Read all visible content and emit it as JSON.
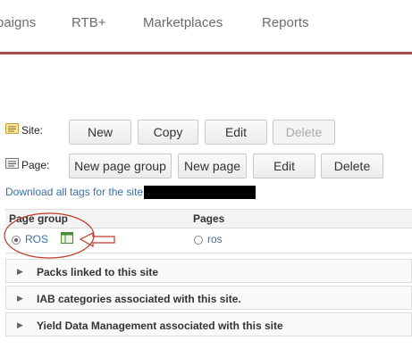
{
  "nav": {
    "items": [
      "paigns",
      "RTB+",
      "Marketplaces",
      "Reports"
    ]
  },
  "site": {
    "label": "Site:",
    "buttons": [
      "New",
      "Copy",
      "Edit",
      "Delete"
    ]
  },
  "page": {
    "label": "Page:",
    "buttons": [
      "New page group",
      "New page",
      "Edit",
      "Delete"
    ]
  },
  "download": {
    "text": "Download all tags for the site"
  },
  "table": {
    "headers": [
      "Page group",
      "Pages"
    ],
    "row": {
      "group": "ROS",
      "page": "ros"
    }
  },
  "accordions": [
    "Packs linked to this site",
    "IAB categories associated with this site.",
    "Yield Data Management associated with this site"
  ],
  "colors": {
    "nav_underline": "#a84a4a",
    "link": "#3a6ea5",
    "annotation": "#c0392b"
  }
}
